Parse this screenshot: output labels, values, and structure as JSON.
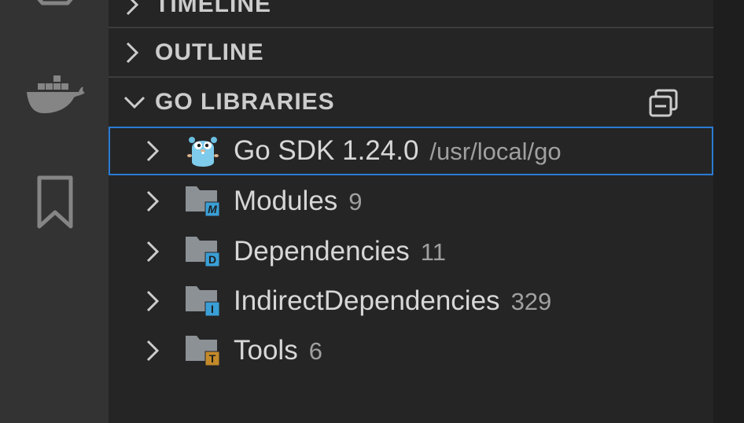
{
  "activity_bar": {
    "icons": [
      "extensions-icon",
      "docker-icon",
      "bookmark-icon"
    ]
  },
  "sections": {
    "timeline": {
      "title": "TIMELINE",
      "expanded": false
    },
    "outline": {
      "title": "OUTLINE",
      "expanded": false
    },
    "go_libraries": {
      "title": "GO LIBRARIES",
      "expanded": true,
      "action_icon": "collapse-all-icon"
    }
  },
  "tree": {
    "items": [
      {
        "label": "Go SDK 1.24.0",
        "description": "/usr/local/go",
        "icon": "gopher-icon",
        "selected": true
      },
      {
        "label": "Modules",
        "description": "9",
        "icon": "folder-modules-icon",
        "badge": "M",
        "badge_color": "#3a9fd6"
      },
      {
        "label": "Dependencies",
        "description": "11",
        "icon": "folder-dependencies-icon",
        "badge": "D",
        "badge_color": "#3a9fd6"
      },
      {
        "label": "IndirectDependencies",
        "description": "329",
        "icon": "folder-indirect-icon",
        "badge": "I",
        "badge_color": "#3a9fd6"
      },
      {
        "label": "Tools",
        "description": "6",
        "icon": "folder-tools-icon",
        "badge": "T",
        "badge_color": "#c48a2a"
      }
    ]
  },
  "colors": {
    "sidebar_bg": "#252526",
    "activity_bg": "#333333",
    "focus_border": "#2a7bd3",
    "folder_gray": "#8c9196"
  }
}
